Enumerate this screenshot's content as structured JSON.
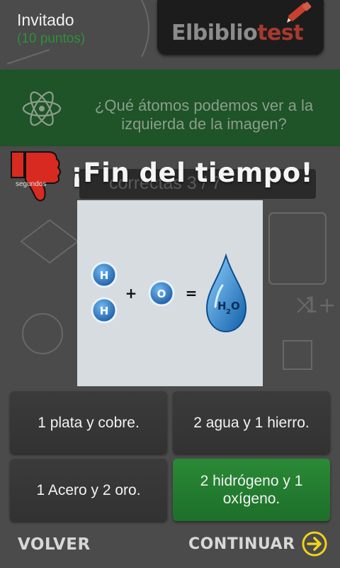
{
  "user": {
    "name": "Invitado",
    "points": "(10 puntos)"
  },
  "logo": {
    "text_main": "Elbiblio",
    "text_accent": "test",
    "icon": "pencil-icon"
  },
  "question": {
    "icon": "atom-icon",
    "text": "¿Qué átomos podemos ver a la izquierda de la imagen?"
  },
  "counter": {
    "text": "correctas 3 / 7"
  },
  "overlay": {
    "icon": "thumbs-down-icon",
    "caption": "segundos",
    "title": "¡Fin del tiempo!"
  },
  "image": {
    "atoms_left": [
      "H",
      "H"
    ],
    "plus": "+",
    "atom_right": "O",
    "equals": "=",
    "molecule": "H",
    "molecule_sub": "2",
    "molecule_tail": "O"
  },
  "answers": [
    {
      "label": "1 plata y cobre.",
      "correct": false
    },
    {
      "label": "2 agua y 1 hierro.",
      "correct": false
    },
    {
      "label": "1 Acero y 2 oro.",
      "correct": false
    },
    {
      "label": "2 hidrógeno y 1 oxígeno.",
      "correct": true
    }
  ],
  "footer": {
    "back_label": "VOLVER",
    "continue_label": "CONTINUAR",
    "continue_icon": "arrow-right-circle-icon"
  },
  "colors": {
    "background": "#4a4b4a",
    "banner": "#1f5328",
    "correct_answer": "#2a8a36",
    "points": "#2f8f3c",
    "arrow": "#f2d11a",
    "thumb": "#d82a20"
  }
}
